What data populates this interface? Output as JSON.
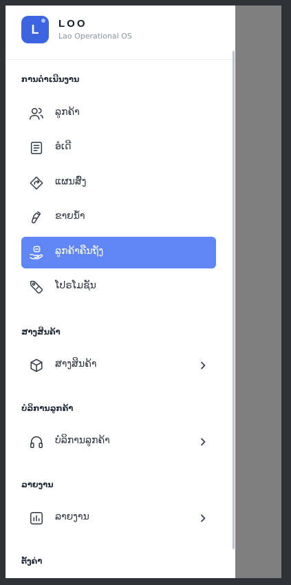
{
  "brand": {
    "logo_letter": "L",
    "title": "LOO",
    "subtitle": "Lao Operational OS"
  },
  "sections": [
    {
      "title": "ການດຳເນີນງານ",
      "items": [
        {
          "label": "ລູກຄ້າ",
          "icon": "users-icon",
          "active": false
        },
        {
          "label": "ອໍເດີ",
          "icon": "receipt-icon",
          "active": false
        },
        {
          "label": "ແຜນສົ່ງ",
          "icon": "route-icon",
          "active": false
        },
        {
          "label": "ຂາຍນ້ຳ",
          "icon": "water-bottle-icon",
          "active": false
        },
        {
          "label": "ລູກຄ້າຄືນຖັງ",
          "icon": "hand-return-icon",
          "active": true
        },
        {
          "label": "ໂປຣໂມຊັນ",
          "icon": "tag-icon",
          "active": false
        }
      ]
    },
    {
      "title": "ສາງສິນຄ້າ",
      "items": [
        {
          "label": "ສາງສິນຄ້າ",
          "icon": "box-icon",
          "expandable": true
        }
      ]
    },
    {
      "title": "ບໍລິການລູກຄ້າ",
      "items": [
        {
          "label": "ບໍລິການລູກຄ້າ",
          "icon": "headset-icon",
          "expandable": true
        }
      ]
    },
    {
      "title": "ລາຍງານ",
      "items": [
        {
          "label": "ລາຍງານ",
          "icon": "bar-chart-icon",
          "expandable": true
        }
      ]
    },
    {
      "title": "ຕັ້ງຄ່າ",
      "items": []
    }
  ],
  "colors": {
    "accent": "#5f86f4",
    "logo": "#3c63e0",
    "overlay": "#7f7f7f",
    "window_border": "#2f3338"
  }
}
